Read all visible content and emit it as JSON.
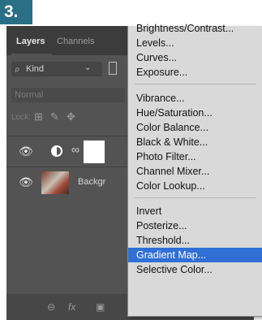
{
  "step_label": "3.",
  "tabs": {
    "active": "Layers",
    "inactive": "Channels"
  },
  "filter": {
    "search_glyph": "⌕",
    "kind_label": "Kind",
    "chevron": "⌄"
  },
  "blend_mode": "Normal",
  "lock": {
    "label": "Lock:",
    "icons": [
      "⊞",
      "✎",
      "✥"
    ]
  },
  "layers": [
    {
      "eye": "👁",
      "link": "∞"
    },
    {
      "eye": "👁",
      "name": "Backgr"
    }
  ],
  "bottom_icons": [
    "⊖",
    "fx",
    "▣",
    "◐",
    "▬",
    "⊡",
    "🗑"
  ],
  "menu": {
    "items_group1": [
      "Brightness/Contrast...",
      "Levels...",
      "Curves...",
      "Exposure..."
    ],
    "items_group2": [
      "Vibrance...",
      "Hue/Saturation...",
      "Color Balance...",
      "Black & White...",
      "Photo Filter...",
      "Channel Mixer...",
      "Color Lookup..."
    ],
    "items_group3": [
      "Invert",
      "Posterize...",
      "Threshold...",
      "Gradient Map...",
      "Selective Color..."
    ],
    "highlighted": "Gradient Map...",
    "highlight_color": "#2f6fd6"
  }
}
